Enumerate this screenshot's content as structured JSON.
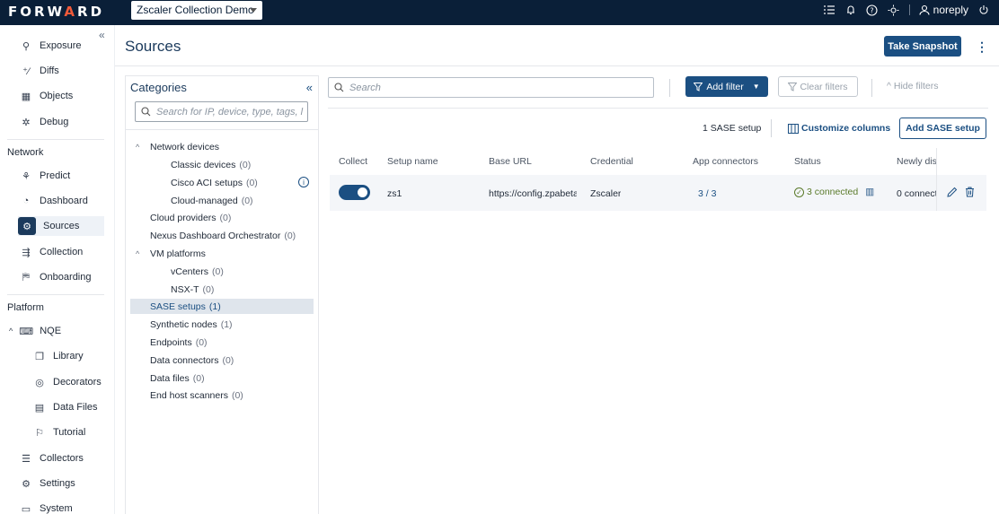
{
  "app": {
    "logo_text_1": "FORW",
    "logo_text_2": "A",
    "logo_text_3": "RD",
    "workspace": "Zscaler Collection Demo",
    "user": "noreply"
  },
  "nav": {
    "items_top": [
      {
        "label": "Exposure",
        "icon": "exposure-icon"
      },
      {
        "label": "Diffs",
        "icon": "diffs-icon"
      },
      {
        "label": "Objects",
        "icon": "objects-icon"
      },
      {
        "label": "Debug",
        "icon": "bug-icon"
      }
    ],
    "section_network": "Network",
    "items_network": [
      {
        "label": "Predict",
        "icon": "predict-icon"
      },
      {
        "label": "Dashboard",
        "icon": "dashboard-icon"
      },
      {
        "label": "Sources",
        "icon": "sources-icon"
      },
      {
        "label": "Collection",
        "icon": "collection-icon"
      },
      {
        "label": "Onboarding",
        "icon": "onboarding-icon"
      }
    ],
    "section_platform": "Platform",
    "nqe": "NQE",
    "items_nqe": [
      {
        "label": "Library",
        "icon": "library-icon"
      },
      {
        "label": "Decorators",
        "icon": "decorators-icon"
      },
      {
        "label": "Data Files",
        "icon": "data-files-icon"
      },
      {
        "label": "Tutorial",
        "icon": "tutorial-icon"
      }
    ],
    "items_platform": [
      {
        "label": "Collectors",
        "icon": "collectors-icon"
      },
      {
        "label": "Settings",
        "icon": "settings-icon"
      },
      {
        "label": "System",
        "icon": "system-icon"
      }
    ]
  },
  "page": {
    "title": "Sources",
    "take_snapshot": "Take Snapshot"
  },
  "categories": {
    "title": "Categories",
    "search_placeholder": "Search for IP, device, type, tags, l",
    "rows": [
      {
        "label": "Network devices",
        "count": "",
        "level": 0,
        "chevron": "^"
      },
      {
        "label": "Classic devices",
        "count": "(0)",
        "level": 2
      },
      {
        "label": "Cisco ACI setups",
        "count": "(0)",
        "level": 2
      },
      {
        "label": "Cloud-managed",
        "count": "(0)",
        "level": 2
      },
      {
        "label": "Cloud providers",
        "count": "(0)",
        "level": 1
      },
      {
        "label": "Nexus Dashboard Orchestrator",
        "count": "(0)",
        "level": 1
      },
      {
        "label": "VM platforms",
        "count": "",
        "level": 0,
        "chevron": "^"
      },
      {
        "label": "vCenters",
        "count": "(0)",
        "level": 2
      },
      {
        "label": "NSX-T",
        "count": "(0)",
        "level": 2
      },
      {
        "label": "SASE setups",
        "count": "(1)",
        "level": 1,
        "selected": true
      },
      {
        "label": "Synthetic nodes",
        "count": "(1)",
        "level": 1
      },
      {
        "label": "Endpoints",
        "count": "(0)",
        "level": 1
      },
      {
        "label": "Data connectors",
        "count": "(0)",
        "level": 1
      },
      {
        "label": "Data files",
        "count": "(0)",
        "level": 1
      },
      {
        "label": "End host scanners",
        "count": "(0)",
        "level": 1
      }
    ]
  },
  "toolbar": {
    "search_placeholder": "Search",
    "add_filter": "Add filter",
    "clear_filters": "Clear filters",
    "hide_filters": "Hide filters",
    "setup_count": "1 SASE setup",
    "customize_columns": "Customize columns",
    "add_sase_setup": "Add SASE setup"
  },
  "table": {
    "headers": [
      "Collect",
      "Setup name",
      "Base URL",
      "Credential",
      "App connectors",
      "Status",
      "Newly disc"
    ],
    "row": {
      "setup_name": "zs1",
      "base_url": "https://config.zpabeta",
      "credential": "Zscaler",
      "app_connectors": "3 / 3",
      "status": "3 connected",
      "newly_discovered": "0 connect"
    }
  },
  "colors": {
    "topbar": "#0a1f38",
    "primary": "#1b4f82",
    "logo_accent": "#f15a3a",
    "status_ok": "#5a7a2a"
  }
}
